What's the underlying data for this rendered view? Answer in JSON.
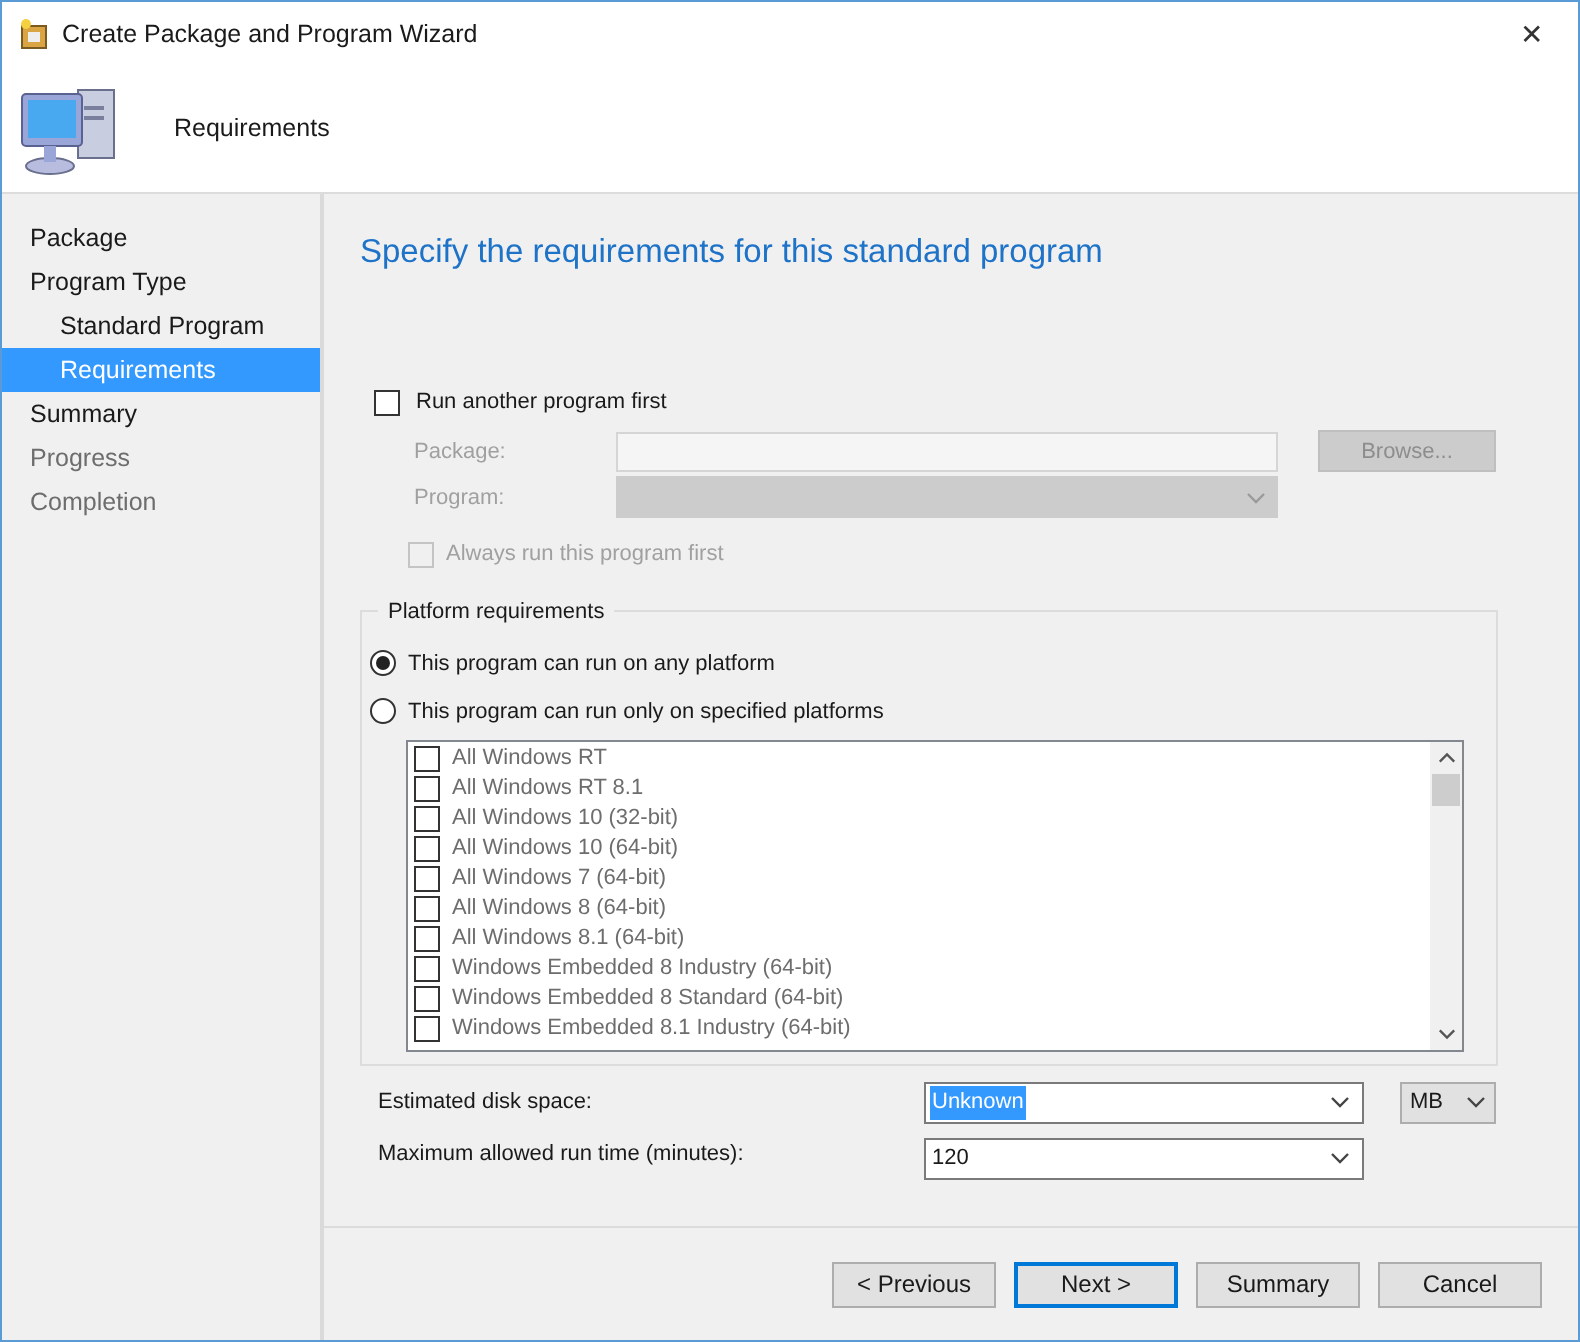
{
  "window": {
    "title": "Create Package and Program Wizard",
    "close": "✕"
  },
  "header": {
    "title": "Requirements"
  },
  "nav": [
    {
      "label": "Package",
      "selected": false,
      "disabled": false
    },
    {
      "label": "Program Type",
      "selected": false,
      "disabled": false,
      "children": [
        {
          "label": "Standard Program",
          "selected": false,
          "disabled": false
        },
        {
          "label": "Requirements",
          "selected": true,
          "disabled": false
        }
      ]
    },
    {
      "label": "Summary",
      "selected": false,
      "disabled": false
    },
    {
      "label": "Progress",
      "selected": false,
      "disabled": true
    },
    {
      "label": "Completion",
      "selected": false,
      "disabled": true
    }
  ],
  "page_title": "Specify the requirements for this standard program",
  "run_first": {
    "label": "Run another program first",
    "checked": false,
    "package_label": "Package:",
    "program_label": "Program:",
    "browse": "Browse...",
    "always_label": "Always run this program first",
    "always_checked": false,
    "disabled": true
  },
  "platform": {
    "title": "Platform requirements",
    "options": [
      {
        "label": "This program can run on any platform",
        "selected": true
      },
      {
        "label": "This program can run only on specified platforms",
        "selected": false
      }
    ],
    "platforms": [
      {
        "label": "All Windows RT",
        "checked": false
      },
      {
        "label": "All Windows RT 8.1",
        "checked": false
      },
      {
        "label": "All Windows 10 (32-bit)",
        "checked": false
      },
      {
        "label": "All Windows 10 (64-bit)",
        "checked": false
      },
      {
        "label": "All Windows 7 (64-bit)",
        "checked": false
      },
      {
        "label": "All Windows 8 (64-bit)",
        "checked": false
      },
      {
        "label": "All Windows 8.1 (64-bit)",
        "checked": false
      },
      {
        "label": "Windows Embedded 8 Industry (64-bit)",
        "checked": false
      },
      {
        "label": "Windows Embedded 8 Standard (64-bit)",
        "checked": false
      },
      {
        "label": "Windows Embedded 8.1 Industry (64-bit)",
        "checked": false
      }
    ]
  },
  "disk_space": {
    "label": "Estimated disk space:",
    "value": "Unknown",
    "unit": "MB"
  },
  "run_time": {
    "label": "Maximum allowed run time (minutes):",
    "value": "120"
  },
  "buttons": [
    {
      "label": "< Previous",
      "default": false
    },
    {
      "label": "Next >",
      "default": true
    },
    {
      "label": "Summary",
      "default": false
    },
    {
      "label": "Cancel",
      "default": false
    }
  ]
}
